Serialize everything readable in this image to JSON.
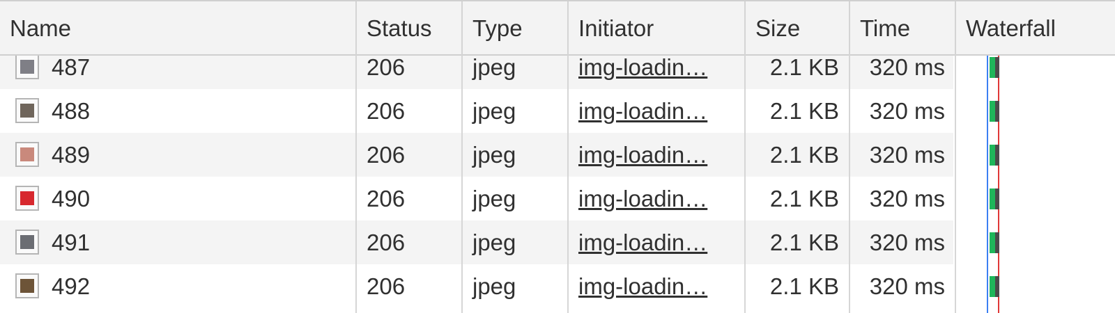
{
  "columns": {
    "name": "Name",
    "status": "Status",
    "type": "Type",
    "initiator": "Initiator",
    "size": "Size",
    "time": "Time",
    "waterfall": "Waterfall"
  },
  "rows": [
    {
      "name": "487",
      "status": "206",
      "type": "jpeg",
      "initiator": "img-loadin…",
      "size": "2.1 KB",
      "time": "320 ms"
    },
    {
      "name": "488",
      "status": "206",
      "type": "jpeg",
      "initiator": "img-loadin…",
      "size": "2.1 KB",
      "time": "320 ms"
    },
    {
      "name": "489",
      "status": "206",
      "type": "jpeg",
      "initiator": "img-loadin…",
      "size": "2.1 KB",
      "time": "320 ms"
    },
    {
      "name": "490",
      "status": "206",
      "type": "jpeg",
      "initiator": "img-loadin…",
      "size": "2.1 KB",
      "time": "320 ms"
    },
    {
      "name": "491",
      "status": "206",
      "type": "jpeg",
      "initiator": "img-loadin…",
      "size": "2.1 KB",
      "time": "320 ms"
    },
    {
      "name": "492",
      "status": "206",
      "type": "jpeg",
      "initiator": "img-loadin…",
      "size": "2.1 KB",
      "time": "320 ms"
    }
  ],
  "thumbnail_colors": [
    "#7f7f86",
    "#6f655b",
    "#c9897c",
    "#d7282e",
    "#6b6d73",
    "#6d5438"
  ],
  "icons": {
    "thumbnail": "image-thumbnail-icon"
  },
  "colors": {
    "header_bg": "#f3f3f3",
    "stripe_bg": "#f4f4f4",
    "dom_content_loaded_line": "#3b7ff2",
    "load_line": "#e03838",
    "waiting_bar": "#1fb65a",
    "download_bar": "#4b4b4b"
  }
}
